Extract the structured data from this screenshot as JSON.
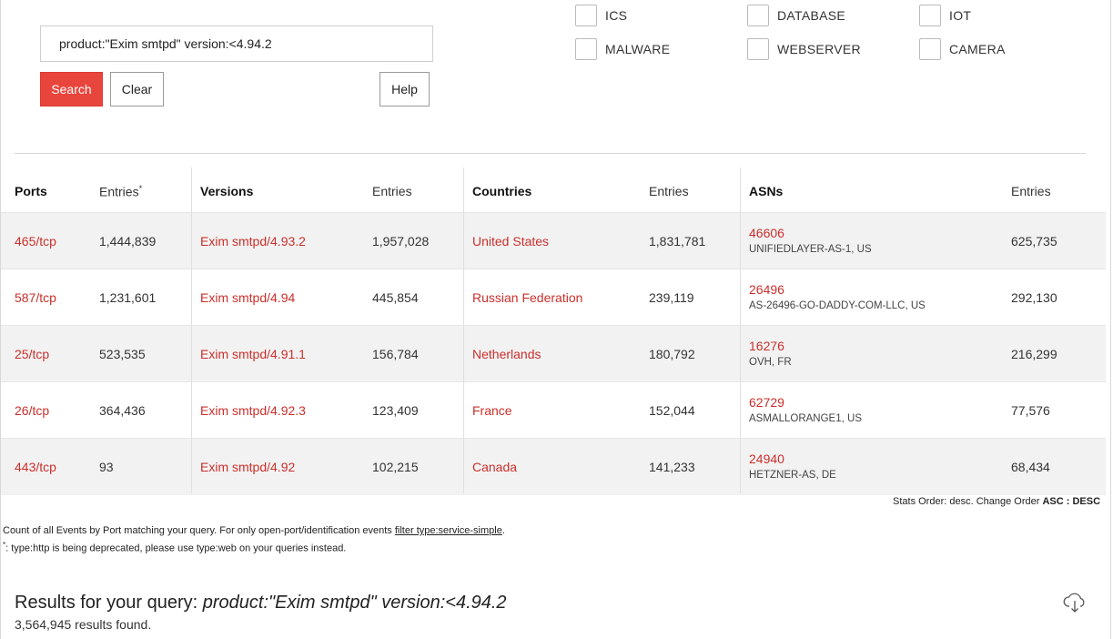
{
  "search": {
    "query": "product:\"Exim smtpd\" version:<4.94.2",
    "search_label": "Search",
    "clear_label": "Clear",
    "help_label": "Help"
  },
  "filters": [
    {
      "label": "ICS"
    },
    {
      "label": "DATABASE"
    },
    {
      "label": "IOT"
    },
    {
      "label": "MALWARE"
    },
    {
      "label": "WEBSERVER"
    },
    {
      "label": "CAMERA"
    }
  ],
  "table": {
    "headers": {
      "ports": "Ports",
      "ports_entries": "Entries",
      "ports_entries_mark": "*",
      "versions": "Versions",
      "versions_entries": "Entries",
      "countries": "Countries",
      "countries_entries": "Entries",
      "asns": "ASNs",
      "asns_entries": "Entries"
    },
    "rows": [
      {
        "port": "465/tcp",
        "port_entries": "1,444,839",
        "version": "Exim smtpd/4.93.2",
        "version_entries": "1,957,028",
        "country": "United States",
        "country_entries": "1,831,781",
        "asn": "46606",
        "asn_name": "UNIFIEDLAYER-AS-1, US",
        "asn_entries": "625,735"
      },
      {
        "port": "587/tcp",
        "port_entries": "1,231,601",
        "version": "Exim smtpd/4.94",
        "version_entries": "445,854",
        "country": "Russian Federation",
        "country_entries": "239,119",
        "asn": "26496",
        "asn_name": "AS-26496-GO-DADDY-COM-LLC, US",
        "asn_entries": "292,130"
      },
      {
        "port": "25/tcp",
        "port_entries": "523,535",
        "version": "Exim smtpd/4.91.1",
        "version_entries": "156,784",
        "country": "Netherlands",
        "country_entries": "180,792",
        "asn": "16276",
        "asn_name": "OVH, FR",
        "asn_entries": "216,299"
      },
      {
        "port": "26/tcp",
        "port_entries": "364,436",
        "version": "Exim smtpd/4.92.3",
        "version_entries": "123,409",
        "country": "France",
        "country_entries": "152,044",
        "asn": "62729",
        "asn_name": "ASMALLORANGE1, US",
        "asn_entries": "77,576"
      },
      {
        "port": "443/tcp",
        "port_entries": "93",
        "version": "Exim smtpd/4.92",
        "version_entries": "102,215",
        "country": "Canada",
        "country_entries": "141,233",
        "asn": "24940",
        "asn_name": "HETZNER-AS, DE",
        "asn_entries": "68,434"
      }
    ]
  },
  "stats_order": {
    "prefix": "Stats Order: desc. Change Order ",
    "asc": "ASC",
    "sep": " : ",
    "desc": "DESC"
  },
  "notes": {
    "line1_prefix": "Count of all Events by Port matching your query. For only open-port/identification events ",
    "line1_link": "filter type:service-simple",
    "line1_suffix": ".",
    "line2_mark": "*",
    "line2_text": ": type:http is being deprecated, please use type:web on your queries instead."
  },
  "results": {
    "title_prefix": "Results for your query: ",
    "title_query": "product:\"Exim smtpd\" version:<4.94.2",
    "count": "3,564,945 results found."
  },
  "icons": {
    "download": "cloud-download-icon"
  },
  "colors": {
    "accent": "#e8453c",
    "link": "#c9302c",
    "row_shade": "#f2f2f2"
  }
}
